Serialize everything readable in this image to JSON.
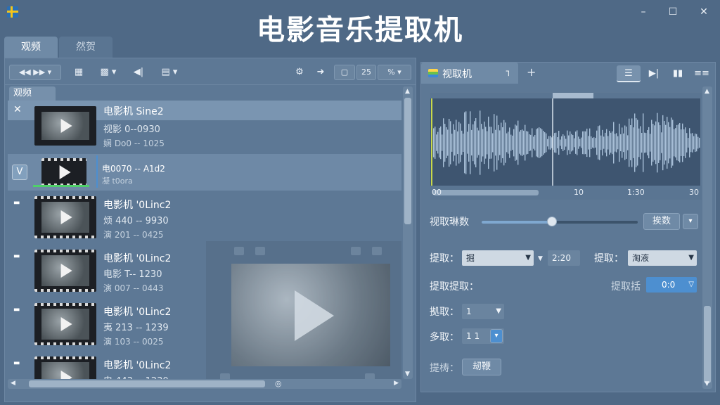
{
  "window": {
    "title": "电影音乐提取机",
    "minimize": "–",
    "maximize": "☐",
    "close": "✕"
  },
  "tabs": [
    {
      "label": "观频"
    },
    {
      "label": "然贺"
    }
  ],
  "left_toolbar": {
    "zoom_value": "25",
    "percent": "%"
  },
  "list": {
    "header": "观频",
    "rows": [
      {
        "mark": "✕",
        "title": "电影机 Sine2",
        "line2": "视影 0--0930",
        "line3": "娴 Do0 -- 1025"
      },
      {
        "mark": "V",
        "title": "电0070 -- A1d2",
        "line2": "凝 t0ora",
        "line3": ""
      },
      {
        "mark": "▬",
        "title": "电影机 '0Linc2",
        "line2": "烦 440 -- 9930",
        "line3": "演 201 -- 0425"
      },
      {
        "mark": "▬",
        "title": "电影机 '0Linc2",
        "line2": "电影 T-- 1230",
        "line3": "演 007 -- 0443"
      },
      {
        "mark": "▬",
        "title": "电影机 '0Linc2",
        "line2": "夷 213 -- 1239",
        "line3": "演 103 -- 0025"
      },
      {
        "mark": "▬",
        "title": "电影机 '0Linc2",
        "line2": "电 443 -- 1230",
        "line3": ""
      }
    ]
  },
  "right_panel": {
    "tab_label": "视取机",
    "tab_close": "┐",
    "add_tab": "+",
    "wave_axis": [
      "00",
      "10",
      "1:30",
      "30"
    ],
    "param_label": "视取琳数",
    "param_button": "挨数",
    "slider_value": 0.45,
    "row1_label": "提取：",
    "row1_value": "掘",
    "row1_time": "2:20",
    "row1_label2": "提取：",
    "row1_value2": "淘液",
    "row2_label": "提取提取：",
    "row2_label2": "提取括",
    "row2_value": "0:0",
    "row3_label": "拠取：",
    "row3_value": "1",
    "row4_label": "多取：",
    "row4_value": "1 1",
    "row5_label": "提梼：",
    "row5_button": "刼鞭"
  },
  "colors": {
    "background": "#4f6986",
    "accent": "#4d8fd0"
  }
}
